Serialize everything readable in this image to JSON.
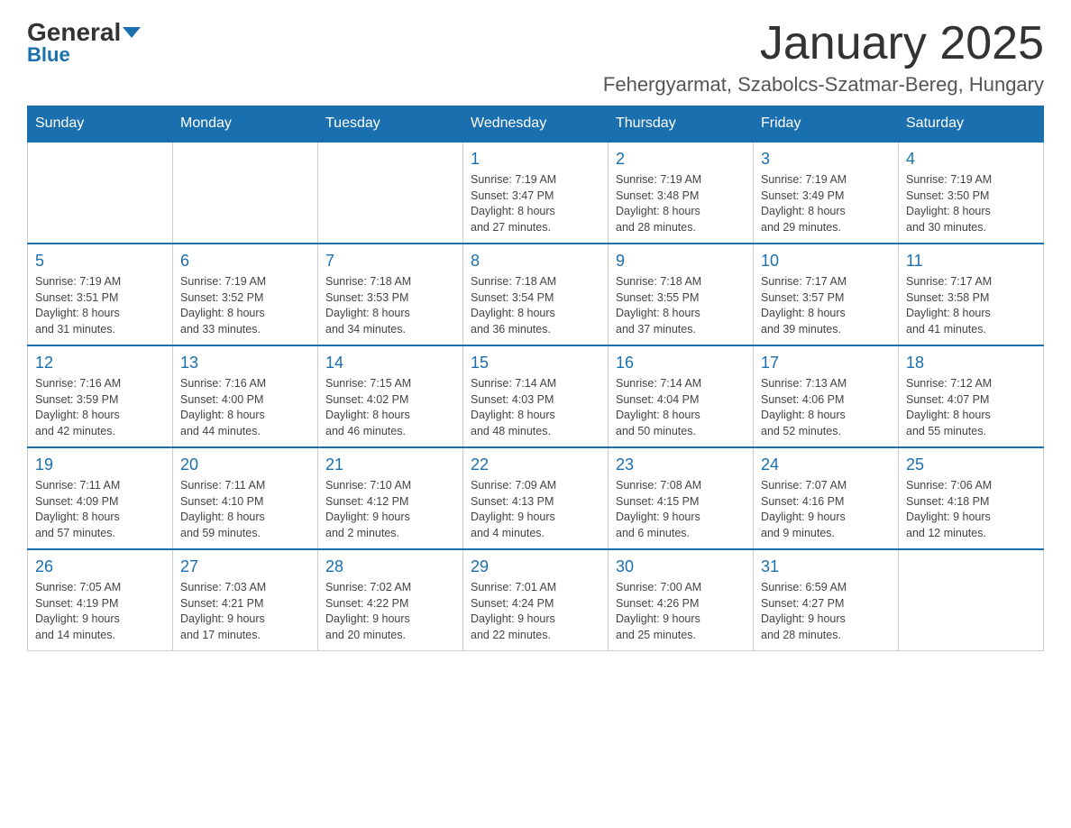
{
  "logo": {
    "text_general": "General",
    "text_blue": "Blue"
  },
  "header": {
    "title": "January 2025",
    "subtitle": "Fehergyarmat, Szabolcs-Szatmar-Bereg, Hungary"
  },
  "weekdays": [
    "Sunday",
    "Monday",
    "Tuesday",
    "Wednesday",
    "Thursday",
    "Friday",
    "Saturday"
  ],
  "weeks": [
    [
      {
        "day": "",
        "info": ""
      },
      {
        "day": "",
        "info": ""
      },
      {
        "day": "",
        "info": ""
      },
      {
        "day": "1",
        "info": "Sunrise: 7:19 AM\nSunset: 3:47 PM\nDaylight: 8 hours\nand 27 minutes."
      },
      {
        "day": "2",
        "info": "Sunrise: 7:19 AM\nSunset: 3:48 PM\nDaylight: 8 hours\nand 28 minutes."
      },
      {
        "day": "3",
        "info": "Sunrise: 7:19 AM\nSunset: 3:49 PM\nDaylight: 8 hours\nand 29 minutes."
      },
      {
        "day": "4",
        "info": "Sunrise: 7:19 AM\nSunset: 3:50 PM\nDaylight: 8 hours\nand 30 minutes."
      }
    ],
    [
      {
        "day": "5",
        "info": "Sunrise: 7:19 AM\nSunset: 3:51 PM\nDaylight: 8 hours\nand 31 minutes."
      },
      {
        "day": "6",
        "info": "Sunrise: 7:19 AM\nSunset: 3:52 PM\nDaylight: 8 hours\nand 33 minutes."
      },
      {
        "day": "7",
        "info": "Sunrise: 7:18 AM\nSunset: 3:53 PM\nDaylight: 8 hours\nand 34 minutes."
      },
      {
        "day": "8",
        "info": "Sunrise: 7:18 AM\nSunset: 3:54 PM\nDaylight: 8 hours\nand 36 minutes."
      },
      {
        "day": "9",
        "info": "Sunrise: 7:18 AM\nSunset: 3:55 PM\nDaylight: 8 hours\nand 37 minutes."
      },
      {
        "day": "10",
        "info": "Sunrise: 7:17 AM\nSunset: 3:57 PM\nDaylight: 8 hours\nand 39 minutes."
      },
      {
        "day": "11",
        "info": "Sunrise: 7:17 AM\nSunset: 3:58 PM\nDaylight: 8 hours\nand 41 minutes."
      }
    ],
    [
      {
        "day": "12",
        "info": "Sunrise: 7:16 AM\nSunset: 3:59 PM\nDaylight: 8 hours\nand 42 minutes."
      },
      {
        "day": "13",
        "info": "Sunrise: 7:16 AM\nSunset: 4:00 PM\nDaylight: 8 hours\nand 44 minutes."
      },
      {
        "day": "14",
        "info": "Sunrise: 7:15 AM\nSunset: 4:02 PM\nDaylight: 8 hours\nand 46 minutes."
      },
      {
        "day": "15",
        "info": "Sunrise: 7:14 AM\nSunset: 4:03 PM\nDaylight: 8 hours\nand 48 minutes."
      },
      {
        "day": "16",
        "info": "Sunrise: 7:14 AM\nSunset: 4:04 PM\nDaylight: 8 hours\nand 50 minutes."
      },
      {
        "day": "17",
        "info": "Sunrise: 7:13 AM\nSunset: 4:06 PM\nDaylight: 8 hours\nand 52 minutes."
      },
      {
        "day": "18",
        "info": "Sunrise: 7:12 AM\nSunset: 4:07 PM\nDaylight: 8 hours\nand 55 minutes."
      }
    ],
    [
      {
        "day": "19",
        "info": "Sunrise: 7:11 AM\nSunset: 4:09 PM\nDaylight: 8 hours\nand 57 minutes."
      },
      {
        "day": "20",
        "info": "Sunrise: 7:11 AM\nSunset: 4:10 PM\nDaylight: 8 hours\nand 59 minutes."
      },
      {
        "day": "21",
        "info": "Sunrise: 7:10 AM\nSunset: 4:12 PM\nDaylight: 9 hours\nand 2 minutes."
      },
      {
        "day": "22",
        "info": "Sunrise: 7:09 AM\nSunset: 4:13 PM\nDaylight: 9 hours\nand 4 minutes."
      },
      {
        "day": "23",
        "info": "Sunrise: 7:08 AM\nSunset: 4:15 PM\nDaylight: 9 hours\nand 6 minutes."
      },
      {
        "day": "24",
        "info": "Sunrise: 7:07 AM\nSunset: 4:16 PM\nDaylight: 9 hours\nand 9 minutes."
      },
      {
        "day": "25",
        "info": "Sunrise: 7:06 AM\nSunset: 4:18 PM\nDaylight: 9 hours\nand 12 minutes."
      }
    ],
    [
      {
        "day": "26",
        "info": "Sunrise: 7:05 AM\nSunset: 4:19 PM\nDaylight: 9 hours\nand 14 minutes."
      },
      {
        "day": "27",
        "info": "Sunrise: 7:03 AM\nSunset: 4:21 PM\nDaylight: 9 hours\nand 17 minutes."
      },
      {
        "day": "28",
        "info": "Sunrise: 7:02 AM\nSunset: 4:22 PM\nDaylight: 9 hours\nand 20 minutes."
      },
      {
        "day": "29",
        "info": "Sunrise: 7:01 AM\nSunset: 4:24 PM\nDaylight: 9 hours\nand 22 minutes."
      },
      {
        "day": "30",
        "info": "Sunrise: 7:00 AM\nSunset: 4:26 PM\nDaylight: 9 hours\nand 25 minutes."
      },
      {
        "day": "31",
        "info": "Sunrise: 6:59 AM\nSunset: 4:27 PM\nDaylight: 9 hours\nand 28 minutes."
      },
      {
        "day": "",
        "info": ""
      }
    ]
  ]
}
